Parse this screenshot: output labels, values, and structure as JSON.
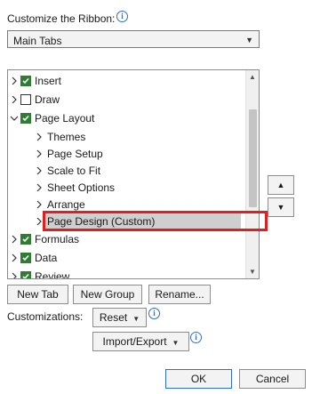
{
  "header": {
    "customize_label": "Customize the Ribbon:"
  },
  "ribbon_combo": {
    "value": "Main Tabs"
  },
  "tree": {
    "items": [
      {
        "label": "Insert",
        "expanded": false,
        "checked": true
      },
      {
        "label": "Draw",
        "expanded": false,
        "checked": false
      },
      {
        "label": "Page Layout",
        "expanded": true,
        "checked": true
      },
      {
        "label": "Themes"
      },
      {
        "label": "Page Setup"
      },
      {
        "label": "Scale to Fit"
      },
      {
        "label": "Sheet Options"
      },
      {
        "label": "Arrange"
      },
      {
        "label": "Page Design (Custom)",
        "selected": true
      },
      {
        "label": "Formulas",
        "expanded": false,
        "checked": true
      },
      {
        "label": "Data",
        "expanded": false,
        "checked": true
      },
      {
        "label": "Review",
        "expanded": false,
        "checked": true
      }
    ]
  },
  "buttons": {
    "new_tab": "New Tab",
    "new_group": "New Group",
    "rename": "Rename...",
    "reset": "Reset",
    "import_export": "Import/Export",
    "ok": "OK",
    "cancel": "Cancel"
  },
  "customizations_label": "Customizations:",
  "colors": {
    "check": "#2f7d33",
    "highlight": "#e02020",
    "accent": "#2b6cd6"
  }
}
